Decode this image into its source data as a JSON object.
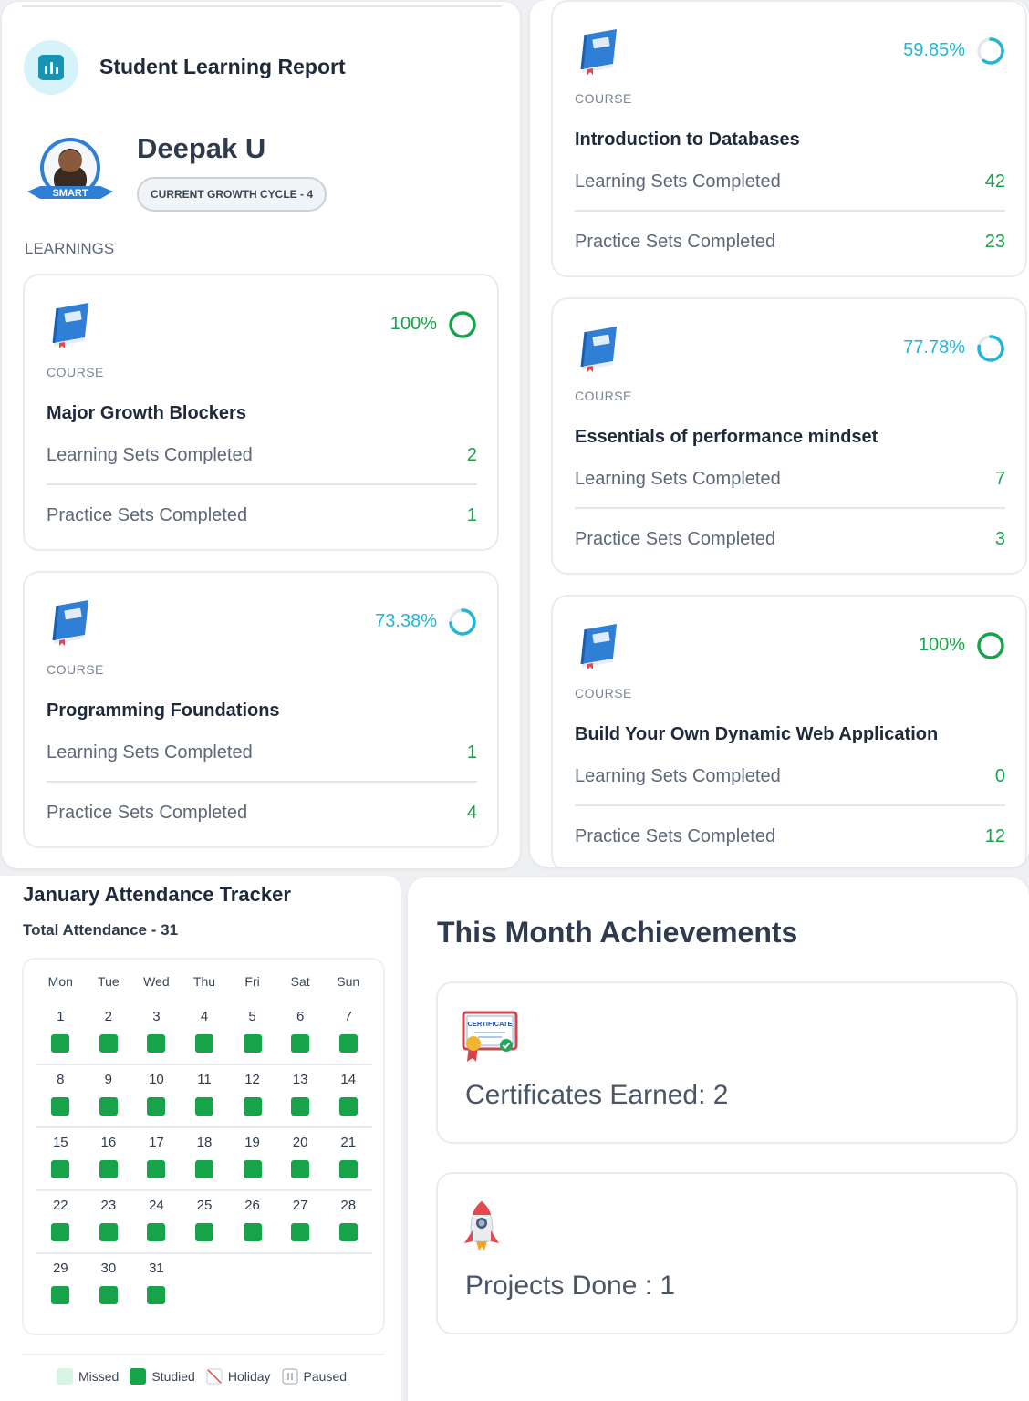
{
  "report": {
    "title": "Student Learning Report",
    "student_name": "Deepak U",
    "avatar_badge": "SMART",
    "cycle": "CURRENT GROWTH CYCLE - 4",
    "section_label": "LEARNINGS",
    "course_kind": "COURSE",
    "learning_label": "Learning Sets Completed",
    "practice_label": "Practice Sets Completed"
  },
  "courses": [
    {
      "name": "Major Growth Blockers",
      "percent": "100%",
      "progress": 1.0,
      "learning": "2",
      "practice": "1"
    },
    {
      "name": "Programming Foundations",
      "percent": "73.38%",
      "progress": 0.7338,
      "learning": "1",
      "practice": "4"
    },
    {
      "name": "Introduction to Databases",
      "percent": "59.85%",
      "progress": 0.5985,
      "learning": "42",
      "practice": "23"
    },
    {
      "name": "Essentials of performance mindset",
      "percent": "77.78%",
      "progress": 0.7778,
      "learning": "7",
      "practice": "3"
    },
    {
      "name": "Build Your Own Dynamic Web Application",
      "percent": "100%",
      "progress": 1.0,
      "learning": "0",
      "practice": "12"
    }
  ],
  "tracker": {
    "title": "January Attendance Tracker",
    "total": "Total Attendance - 31",
    "weekdays": [
      "Mon",
      "Tue",
      "Wed",
      "Thu",
      "Fri",
      "Sat",
      "Sun"
    ],
    "weeks": [
      [
        "1",
        "2",
        "3",
        "4",
        "5",
        "6",
        "7"
      ],
      [
        "8",
        "9",
        "10",
        "11",
        "12",
        "13",
        "14"
      ],
      [
        "15",
        "16",
        "17",
        "18",
        "19",
        "20",
        "21"
      ],
      [
        "22",
        "23",
        "24",
        "25",
        "26",
        "27",
        "28"
      ],
      [
        "29",
        "30",
        "31"
      ]
    ],
    "legend": {
      "missed": "Missed",
      "studied": "Studied",
      "holiday": "Holiday",
      "paused": "Paused"
    }
  },
  "achievements": {
    "title": "This Month Achievements",
    "certificates": "Certificates Earned: 2",
    "certificate_badge": "CERTIFICATE",
    "projects": "Projects Done : 1"
  },
  "colors": {
    "complete": "#17a34a",
    "in_progress": "#22b5d6",
    "studied": "#16a34a",
    "missed": "#d7f5e3",
    "accent": "#1693b5"
  },
  "icons": {
    "report": "bar-chart-icon",
    "course": "blue-book-icon",
    "certificate": "certificate-icon",
    "project": "rocket-icon"
  }
}
